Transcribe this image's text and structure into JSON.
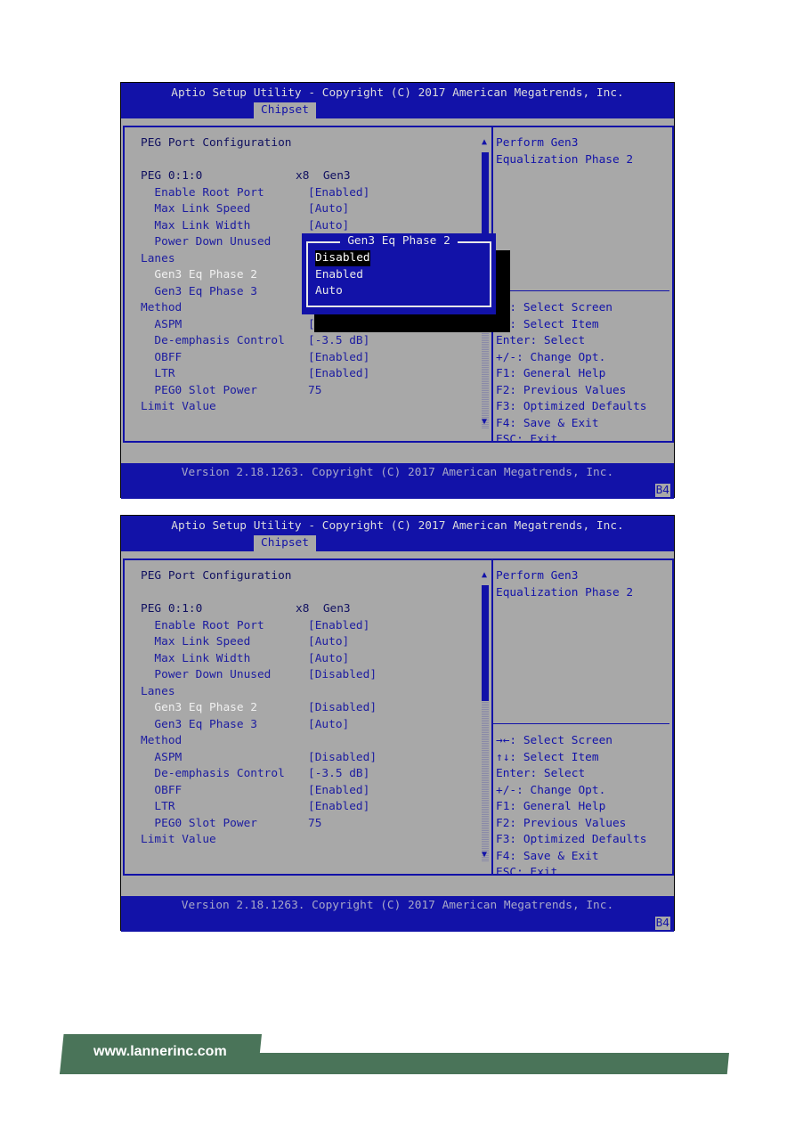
{
  "title": "Aptio Setup Utility - Copyright (C) 2017 American Megatrends, Inc.",
  "tab": "Chipset",
  "footer_version": "Version 2.18.1263. Copyright (C) 2017 American Megatrends, Inc.",
  "footer_code": "B4",
  "colors": {
    "bios_blue": "#1212a8",
    "bios_gray": "#a8a8a8",
    "footer_green": "#4a7459"
  },
  "help_text": [
    "Perform Gen3",
    "Equalization Phase 2"
  ],
  "key_help": [
    "→←: Select Screen",
    "↑↓: Select Item",
    "Enter: Select",
    "+/-: Change Opt.",
    "F1: General Help",
    "F2: Previous Values",
    "F3: Optimized Defaults",
    "F4: Save & Exit",
    "ESC: Exit"
  ],
  "screens": [
    {
      "rows": [
        {
          "label": "PEG Port Configuration",
          "value": "",
          "type": "plain"
        },
        {
          "label": "",
          "value": "",
          "type": "plain"
        },
        {
          "label": "PEG 0:1:0",
          "value": "x8  Gen3",
          "type": "plain"
        },
        {
          "label": "  Enable Root Port",
          "value": "[Enabled]",
          "type": "item"
        },
        {
          "label": "  Max Link Speed",
          "value": "[Auto]",
          "type": "item"
        },
        {
          "label": "  Max Link Width",
          "value": "[Auto]",
          "type": "item"
        },
        {
          "label": "  Power Down Unused",
          "value": "",
          "type": "item"
        },
        {
          "label": "Lanes",
          "value": "",
          "type": "item"
        },
        {
          "label": "  Gen3 Eq Phase 2",
          "value": "",
          "type": "selected"
        },
        {
          "label": "  Gen3 Eq Phase 3",
          "value": "",
          "type": "item"
        },
        {
          "label": "Method",
          "value": "",
          "type": "item"
        },
        {
          "label": "  ASPM",
          "value": "[",
          "type": "item"
        },
        {
          "label": "  De-emphasis Control",
          "value": "[-3.5 dB]",
          "type": "item"
        },
        {
          "label": "  OBFF",
          "value": "[Enabled]",
          "type": "item"
        },
        {
          "label": "  LTR",
          "value": "[Enabled]",
          "type": "item"
        },
        {
          "label": "  PEG0 Slot Power",
          "value": "75",
          "type": "item"
        },
        {
          "label": "Limit Value",
          "value": "",
          "type": "item"
        }
      ],
      "popup": {
        "title": "Gen3 Eq Phase 2",
        "options": [
          "Disabled",
          "Enabled",
          "Auto"
        ],
        "selected": "Disabled"
      }
    },
    {
      "rows": [
        {
          "label": "PEG Port Configuration",
          "value": "",
          "type": "plain"
        },
        {
          "label": "",
          "value": "",
          "type": "plain"
        },
        {
          "label": "PEG 0:1:0",
          "value": "x8  Gen3",
          "type": "plain"
        },
        {
          "label": "  Enable Root Port",
          "value": "[Enabled]",
          "type": "item"
        },
        {
          "label": "  Max Link Speed",
          "value": "[Auto]",
          "type": "item"
        },
        {
          "label": "  Max Link Width",
          "value": "[Auto]",
          "type": "item"
        },
        {
          "label": "  Power Down Unused",
          "value": "[Disabled]",
          "type": "item"
        },
        {
          "label": "Lanes",
          "value": "",
          "type": "item"
        },
        {
          "label": "  Gen3 Eq Phase 2",
          "value": "[Disabled]",
          "type": "selected"
        },
        {
          "label": "  Gen3 Eq Phase 3",
          "value": "[Auto]",
          "type": "item"
        },
        {
          "label": "Method",
          "value": "",
          "type": "item"
        },
        {
          "label": "  ASPM",
          "value": "[Disabled]",
          "type": "item"
        },
        {
          "label": "  De-emphasis Control",
          "value": "[-3.5 dB]",
          "type": "item"
        },
        {
          "label": "  OBFF",
          "value": "[Enabled]",
          "type": "item"
        },
        {
          "label": "  LTR",
          "value": "[Enabled]",
          "type": "item"
        },
        {
          "label": "  PEG0 Slot Power",
          "value": "75",
          "type": "item"
        },
        {
          "label": "Limit Value",
          "value": "",
          "type": "item"
        }
      ]
    }
  ],
  "website": "www.lannerinc.com"
}
